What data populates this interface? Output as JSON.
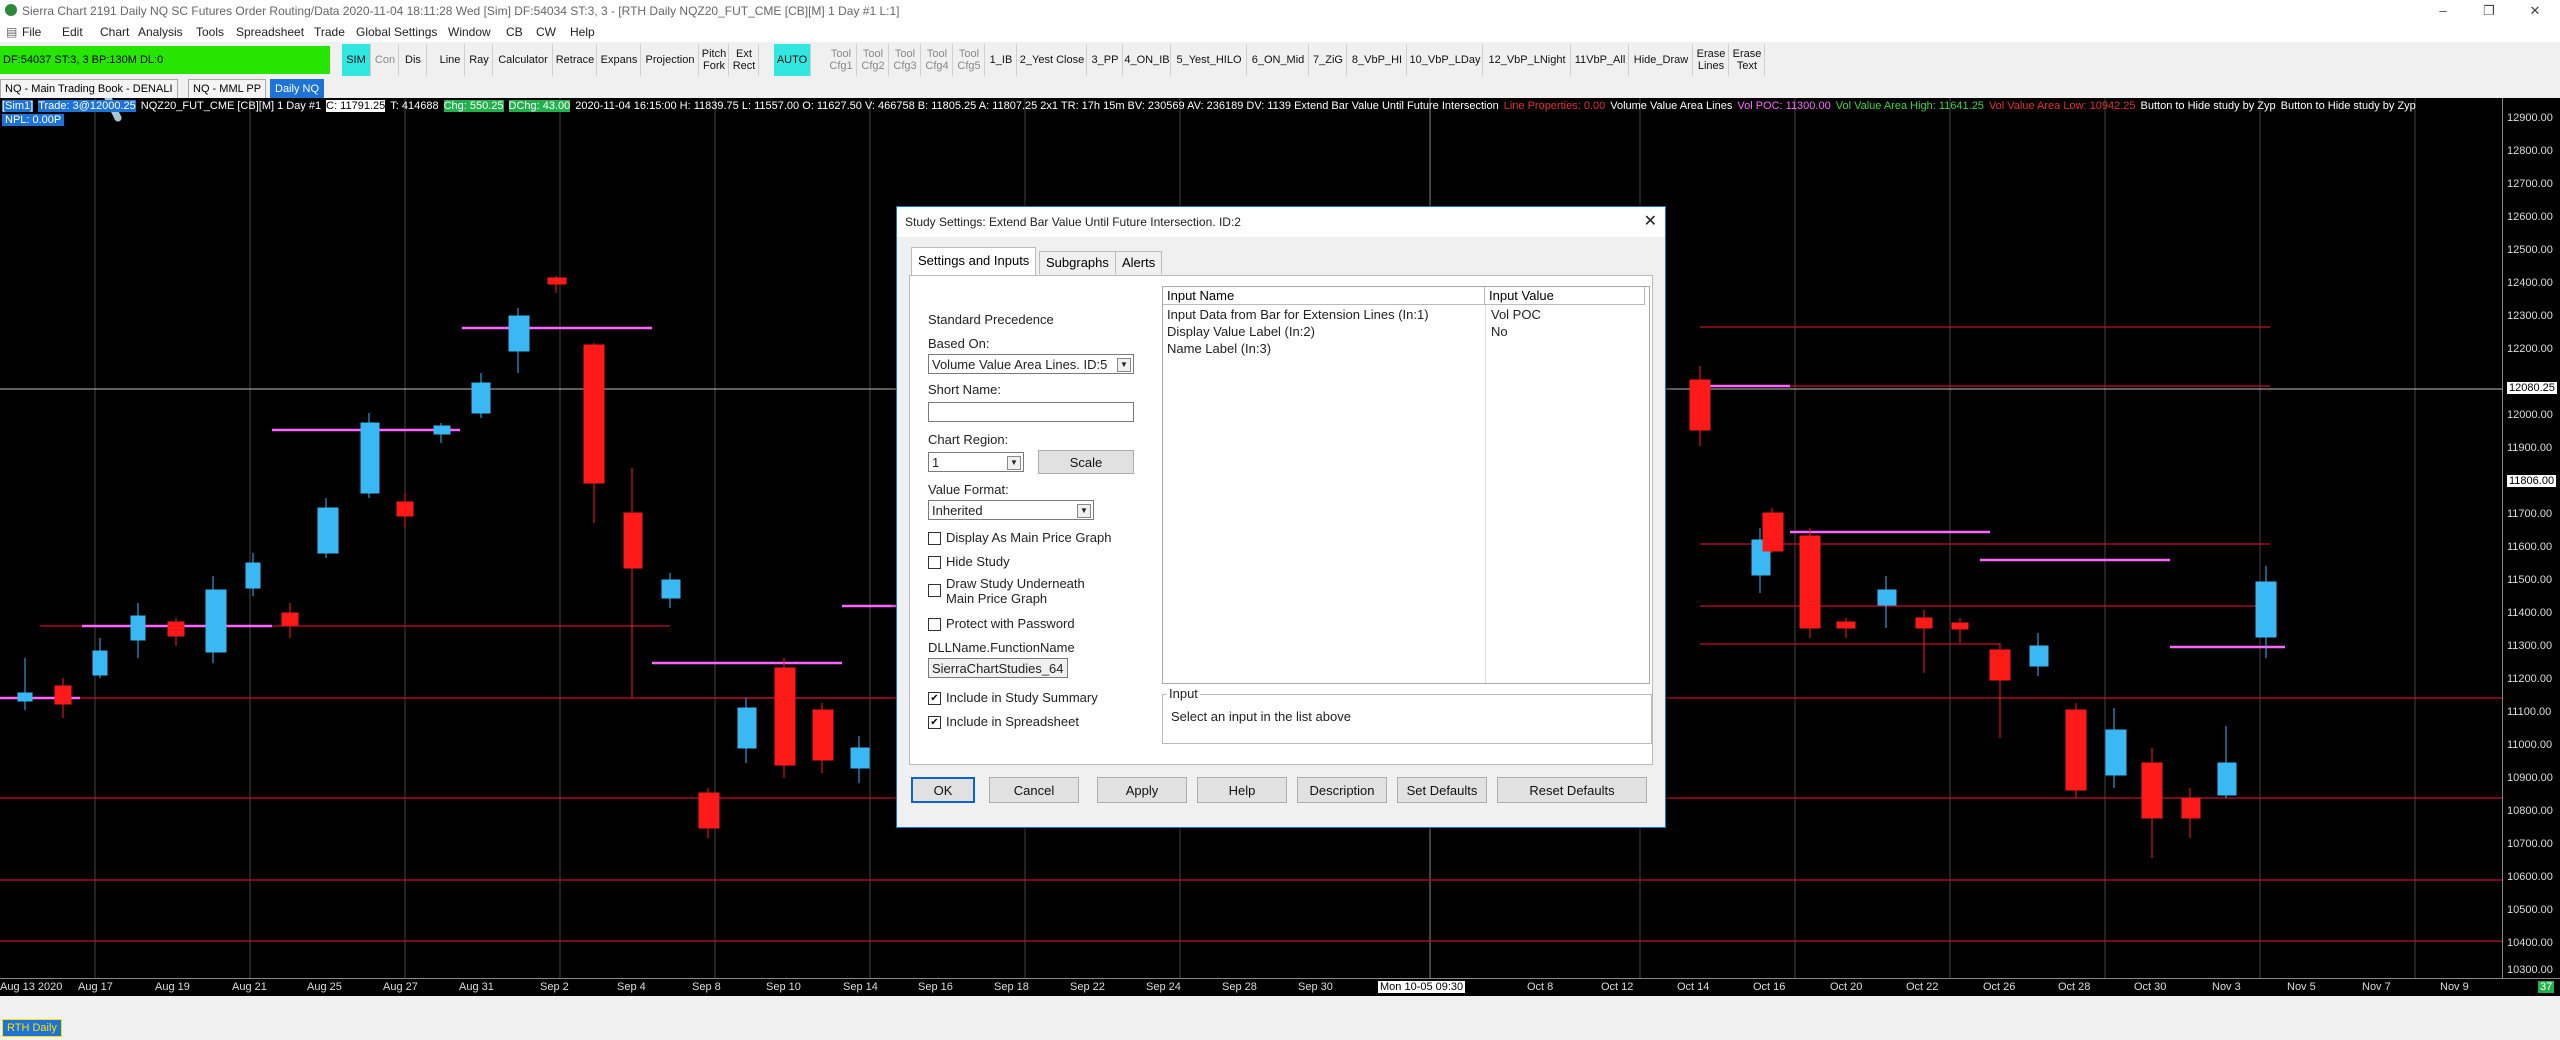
{
  "window": {
    "title": "Sierra Chart 2191 Daily NQ  SC Futures Order Routing/Data 2020-11-04  18:11:28 Wed [Sim]  DF:54034  ST:3, 3 - [RTH Daily NQZ20_FUT_CME [CB][M]  1 Day  #1 L:1]"
  },
  "menu": [
    "File",
    "Edit",
    "Chart",
    "Analysis",
    "Tools",
    "Spreadsheet",
    "Trade",
    "Global Settings",
    "Window",
    "CB",
    "CW",
    "Help"
  ],
  "toolbar": {
    "status_text": "DF:54037  ST:3, 3  BP:130M  DL:0",
    "buttons": [
      "SIM",
      "Con",
      "Dis",
      "Line",
      "Ray",
      "Calculator",
      "Retrace",
      "Expans",
      "Projection",
      "Pitch Fork",
      "Ext Rect",
      "AUTO",
      "Tool Cfg1",
      "Tool Cfg2",
      "Tool Cfg3",
      "Tool Cfg4",
      "Tool Cfg5",
      "1_IB",
      "2_Yest Close",
      "3_PP",
      "4_ON_IB",
      "5_Yest_HILO",
      "6_ON_Mid",
      "7_ZiG",
      "8_VbP_HI",
      "10_VbP_LDay",
      "12_VbP_LNight",
      "11VbP_All",
      "Hide_Draw",
      "Erase Lines",
      "Erase Text"
    ]
  },
  "chart_tabs": [
    "NQ - Main Trading Book - DENALI",
    "NQ - MML PP",
    "Daily NQ"
  ],
  "info_line": {
    "sim": "[Sim1]",
    "trade": "Trade: 3@12000.25",
    "symbol": "NQZ20_FUT_CME [CB][M]  1 Day  #1",
    "close": "C: 11791.25",
    "t": "T: 414688",
    "chg": "Chg: 550.25",
    "dchg": "DChg: 43.00",
    "ohlc": "2020-11-04  16:15:00  H: 11839.75  L: 11557.00  O: 11627.50  V: 466758  B: 11805.25  A: 11807.25  2x1  TR: 17h 15m  BV: 230569  AV: 236189  DV: 1139  Extend Bar Value Until Future Intersection",
    "line_props": "Line Properties: 0.00",
    "vval": "Volume Value Area Lines",
    "vpoc": "Vol POC: 11300.00",
    "vah": "Vol Value Area High: 11641.25",
    "val": "Vol Value Area Low: 10942.25",
    "btn1": "Button to Hide study by Zyp",
    "btn2": "Button to Hide study by Zyp",
    "npl": "NPL: 0.00P"
  },
  "y_axis": [
    "12900.00",
    "12800.00",
    "12700.00",
    "12600.00",
    "12500.00",
    "12400.00",
    "12300.00",
    "12200.00",
    "12100.00",
    "12000.00",
    "11900.00",
    "11800.00",
    "11700.00",
    "11600.00",
    "11500.00",
    "11400.00",
    "11300.00",
    "11200.00",
    "11100.00",
    "11000.00",
    "10900.00",
    "10800.00",
    "10700.00",
    "10600.00",
    "10500.00",
    "10400.00",
    "10300.00"
  ],
  "y_current": "12080.25",
  "y_last": "11806.00",
  "x_axis": [
    "Aug 13 2020",
    "Aug 17",
    "Aug 19",
    "Aug 21",
    "Aug 25",
    "Aug 27",
    "Aug 31",
    "Sep 2",
    "Sep 4",
    "Sep 8",
    "Sep 10",
    "Sep 14",
    "Sep 16",
    "Sep 18",
    "Sep 22",
    "Sep 24",
    "Sep 28",
    "Sep 30",
    "Mon 10-05  09:30",
    "Oct 8",
    "Oct 12",
    "Oct 14",
    "Oct 16",
    "Oct 20",
    "Oct 22",
    "Oct 26",
    "Oct 28",
    "Oct 30",
    "Nov 3",
    "Nov 5",
    "Nov 7",
    "Nov 9"
  ],
  "x_end": "37",
  "bottom_tab": "RTH Daily",
  "dialog": {
    "title": "Study Settings: Extend Bar Value Until Future Intersection. ID:2",
    "close": "✕",
    "tabs": [
      "Settings and Inputs",
      "Subgraphs",
      "Alerts"
    ],
    "standard_precedence": "Standard Precedence",
    "based_on_label": "Based On:",
    "based_on_value": "Volume Value Area Lines. ID:5",
    "short_name_label": "Short Name:",
    "short_name_value": "",
    "chart_region_label": "Chart Region:",
    "chart_region_value": "1",
    "scale_btn": "Scale",
    "value_format_label": "Value Format:",
    "value_format_value": "Inherited",
    "checks": [
      {
        "label": "Display As Main Price Graph",
        "checked": false
      },
      {
        "label": "Hide Study",
        "checked": false
      },
      {
        "label": "Draw Study Underneath Main Price Graph",
        "checked": false
      },
      {
        "label": "Protect with Password",
        "checked": false
      }
    ],
    "dll_label": "DLLName.FunctionName",
    "dll_value": "SierraChartStudies_64",
    "checks2": [
      {
        "label": "Include in Study Summary",
        "checked": true
      },
      {
        "label": "Include in Spreadsheet",
        "checked": true
      }
    ],
    "grid_headers": [
      "Input Name",
      "Input Value"
    ],
    "grid_rows": [
      {
        "name": "Input Data from Bar for Extension Lines   (In:1)",
        "value": "Vol POC"
      },
      {
        "name": "Display Value Label   (In:2)",
        "value": "No"
      },
      {
        "name": "Name Label   (In:3)",
        "value": ""
      }
    ],
    "input_group": "Input",
    "input_hint": "Select an input in the list above",
    "buttons": [
      "OK",
      "Cancel",
      "Apply",
      "Help",
      "Description",
      "Set Defaults",
      "Reset Defaults"
    ]
  }
}
